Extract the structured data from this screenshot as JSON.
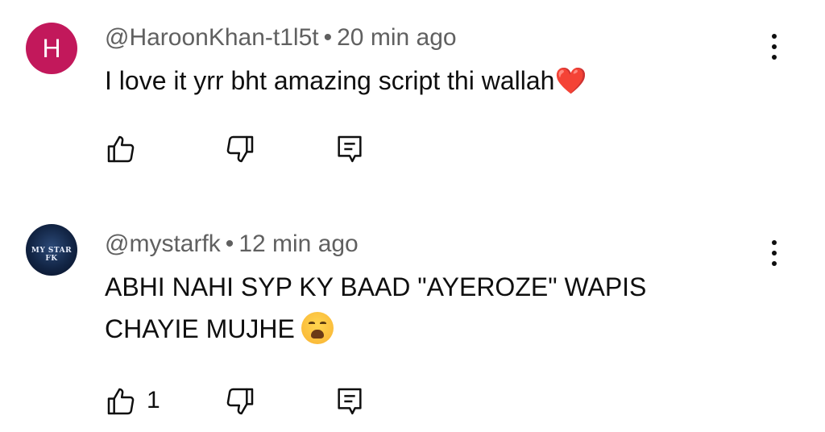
{
  "comments": [
    {
      "avatar_letter": "H",
      "author": "@HaroonKhan-t1l5t",
      "separator": "•",
      "time": "20 min ago",
      "text": "I love it yrr bht amazing script thi wallah",
      "emoji": "❤️",
      "likes": ""
    },
    {
      "avatar_text": "MY STAR FK",
      "author": "@mystarfk",
      "separator": "•",
      "time": "12 min ago",
      "text": "ABHI NAHI SYP KY BAAD \"AYEROZE\" WAPIS CHAYIE MUJHE",
      "emoji": "😩",
      "likes": "1"
    }
  ],
  "icons": {
    "like": "thumbs-up-icon",
    "dislike": "thumbs-down-icon",
    "reply": "reply-icon",
    "menu": "more-vert-icon"
  },
  "colors": {
    "avatar_h": "#c2185b",
    "meta_text": "#606060",
    "body_text": "#0f0f0f"
  }
}
